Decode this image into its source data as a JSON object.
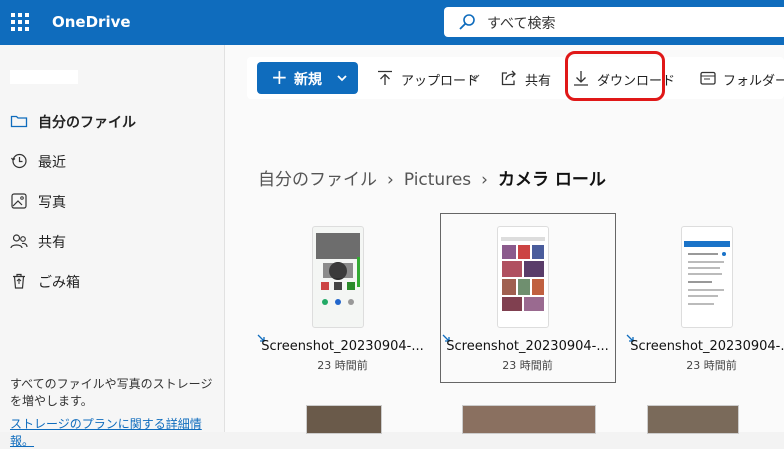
{
  "app": {
    "title": "OneDrive"
  },
  "search": {
    "placeholder": "すべて検索"
  },
  "sidebar": {
    "items": [
      {
        "label": "自分のファイル",
        "icon": "folder-icon",
        "active": true
      },
      {
        "label": "最近",
        "icon": "clock-icon",
        "active": false
      },
      {
        "label": "写真",
        "icon": "photo-icon",
        "active": false
      },
      {
        "label": "共有",
        "icon": "people-icon",
        "active": false
      },
      {
        "label": "ごみ箱",
        "icon": "trash-icon",
        "active": false
      }
    ],
    "storage_text": "すべてのファイルや写真のストレージを増やします。",
    "storage_link": "ストレージのプランに関する詳細情報。"
  },
  "toolbar": {
    "new_label": "新規",
    "upload_label": "アップロード",
    "share_label": "共有",
    "download_label": "ダウンロード",
    "folder_label": "フォルダーからア"
  },
  "breadcrumb": {
    "items": [
      "自分のファイル",
      "Pictures"
    ],
    "current": "カメラ ロール"
  },
  "files": [
    {
      "name": "Screenshot_20230904-...",
      "modified": "23 時間前"
    },
    {
      "name": "Screenshot_20230904-...",
      "modified": "23 時間前"
    },
    {
      "name": "Screenshot_20230904-...",
      "modified": "23 時間前"
    }
  ],
  "colors": {
    "brand": "#0f6cbd",
    "highlight": "#e01818"
  }
}
